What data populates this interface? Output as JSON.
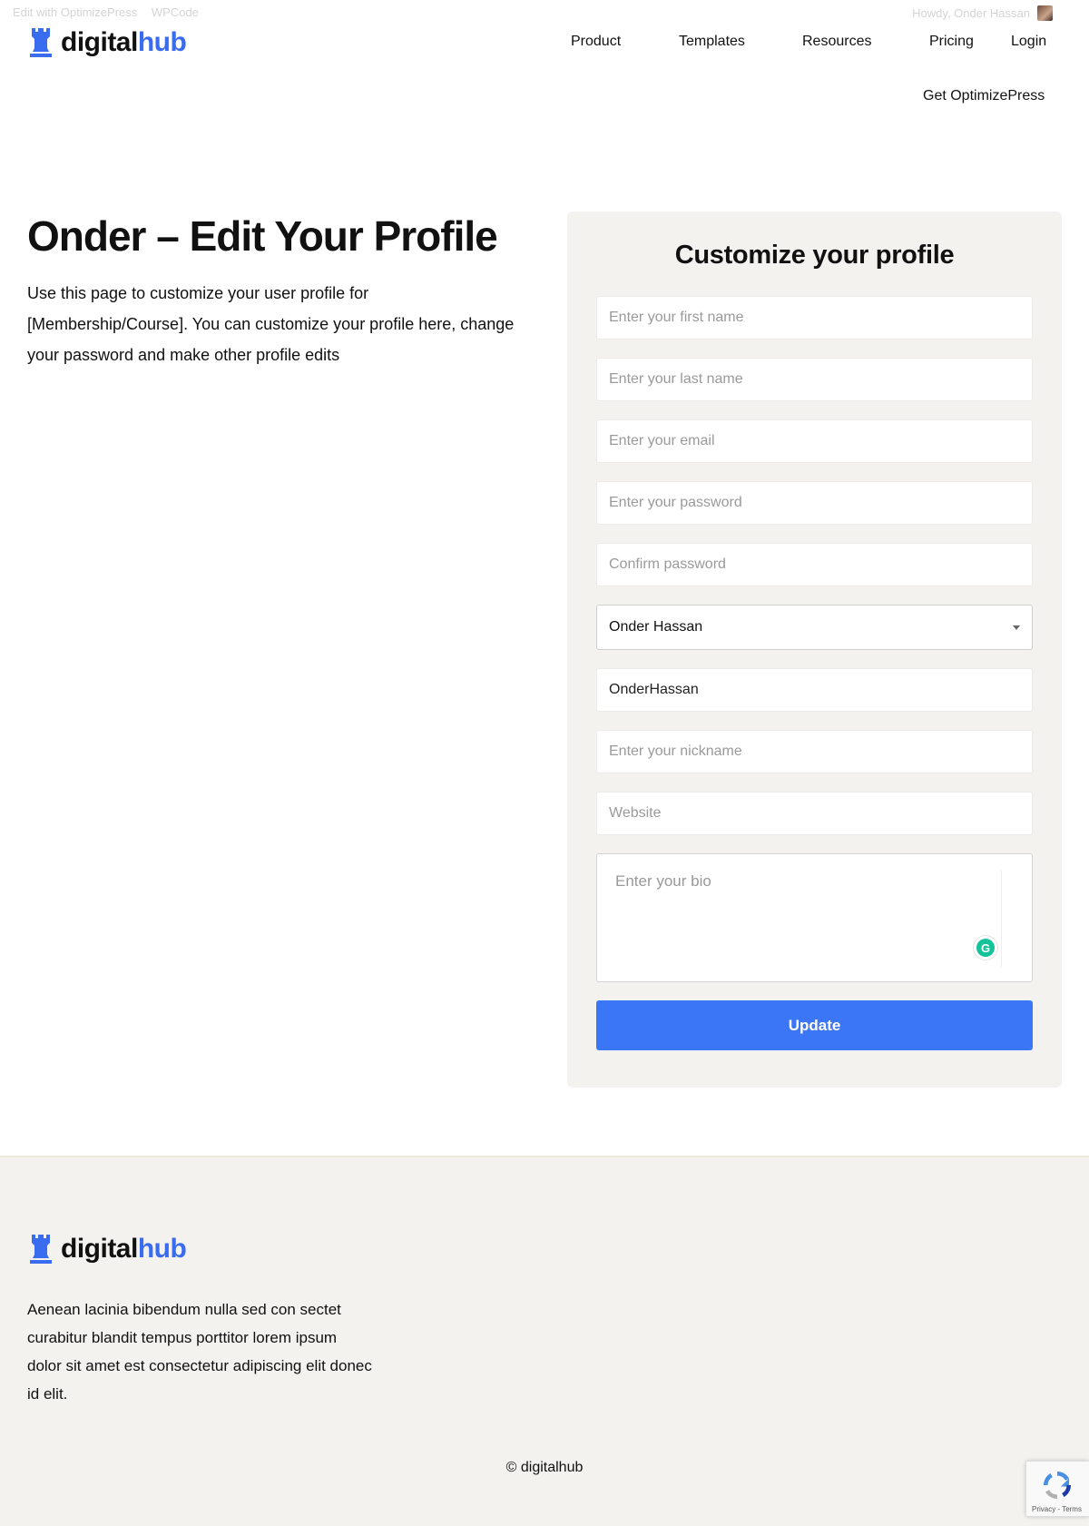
{
  "admin_bar": {
    "edit_link": "Edit with OptimizePress",
    "wpcode": "WPCode",
    "greeting": "Howdy, Onder Hassan"
  },
  "header": {
    "logo_part1": "digital",
    "logo_part2": "hub",
    "nav": [
      "Product",
      "Templates",
      "Resources",
      "Pricing",
      "Login"
    ],
    "cta": "Get OptimizePress"
  },
  "hero": {
    "title": "Onder – Edit Your Profile",
    "description": "Use this page to customize your user profile for [Membership/Course].  You can customize your profile here, change your password and make other profile edits"
  },
  "form": {
    "title": "Customize your profile",
    "first_name_placeholder": "Enter your first name",
    "last_name_placeholder": "Enter your last name",
    "email_placeholder": "Enter your email",
    "password_placeholder": "Enter your password",
    "confirm_placeholder": "Confirm password",
    "display_name_selected": "Onder Hassan",
    "username_value": "OnderHassan",
    "nickname_placeholder": "Enter your nickname",
    "website_placeholder": "Website",
    "bio_placeholder": "Enter your bio",
    "grammarly_letter": "G",
    "submit_label": "Update"
  },
  "footer": {
    "logo_part1": "digital",
    "logo_part2": "hub",
    "description": "Aenean lacinia bibendum nulla sed con sectet curabitur blandit tempus porttitor lorem ipsum dolor sit amet est consectetur adipiscing elit donec id elit.",
    "copyright": "© digitalhub",
    "recaptcha_text": "Privacy - Terms"
  },
  "colors": {
    "brand_blue": "#3a6cf0",
    "button_blue": "#3a76f6",
    "card_bg": "#f3f2ef"
  }
}
